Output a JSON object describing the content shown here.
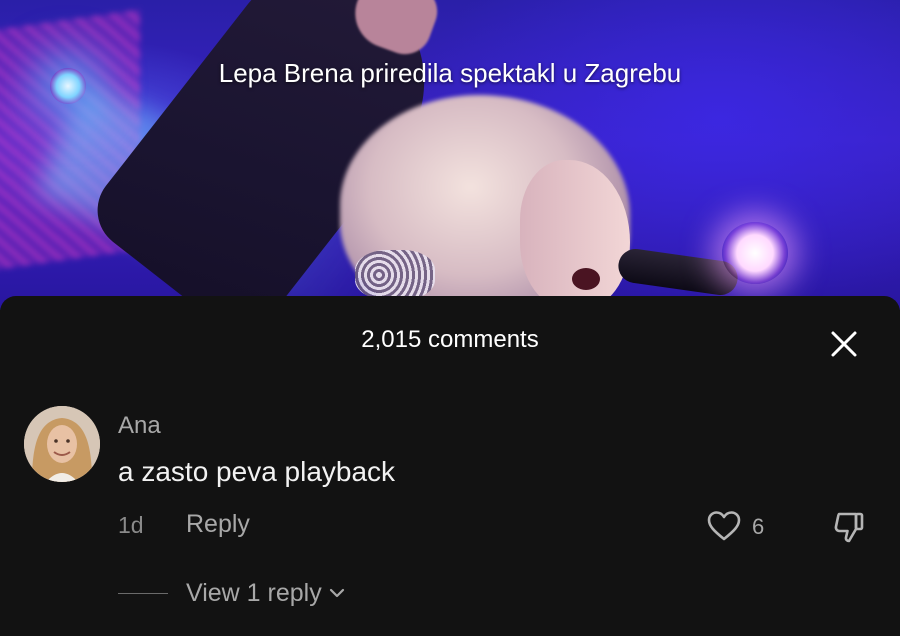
{
  "video": {
    "caption": "Lepa Brena priredila spektakl u Zagrebu"
  },
  "comments_panel": {
    "count_label": "2,015 comments",
    "close_icon": "close-icon"
  },
  "comments": [
    {
      "username": "Ana",
      "text": "a zasto peva playback",
      "time": "1d",
      "reply_label": "Reply",
      "like_count": "6",
      "view_replies_label": "View 1 reply",
      "icons": {
        "like": "heart-outline-icon",
        "dislike": "thumbs-down-icon",
        "expand": "chevron-down-icon"
      }
    }
  ],
  "colors": {
    "sheet_background": "#121212",
    "primary_text": "#ffffff",
    "secondary_text": "#a8a8a8",
    "muted_text": "#8a8a8a"
  }
}
